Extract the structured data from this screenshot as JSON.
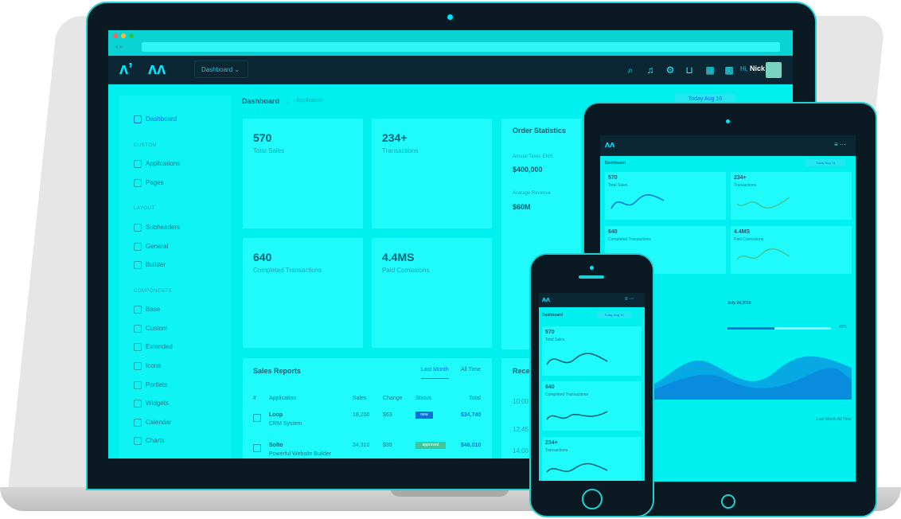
{
  "app": {
    "dropdown_label": "Dashboard",
    "greeting": "Hi,",
    "user_name": "Nick",
    "breadcrumb_title": "Dashboard",
    "breadcrumb_path": "Application",
    "date_button": "Today Aug 16"
  },
  "sidebar": {
    "active_item": "Dashboard",
    "sections": [
      {
        "heading": "CUSTOM",
        "items": [
          "Applications",
          "Pages"
        ]
      },
      {
        "heading": "LAYOUT",
        "items": [
          "Subheaders",
          "General",
          "Builder"
        ]
      },
      {
        "heading": "COMPONENTS",
        "items": [
          "Base",
          "Custom",
          "Extended",
          "Icons",
          "Portlets",
          "Widgets",
          "Calendar",
          "Charts"
        ]
      }
    ]
  },
  "stats": [
    {
      "value": "570",
      "label": "Total Sales"
    },
    {
      "value": "234+",
      "label": "Transactions"
    },
    {
      "value": "640",
      "label": "Completed Transactions"
    },
    {
      "value": "4.4MS",
      "label": "Paid Comissions"
    }
  ],
  "order_statistics": {
    "title": "Order Statistics",
    "annual_label": "Annual Taxes EMS",
    "annual_value": "$400,000",
    "avg_label": "Avarage Revenue",
    "avg_value": "$60M"
  },
  "sales_reports": {
    "title": "Sales Reports",
    "tabs": [
      "Last Month",
      "All Time"
    ],
    "columns": [
      "#",
      "Application",
      "Sales",
      "Change",
      "Status",
      "Total"
    ],
    "rows": [
      {
        "name": "Loop",
        "desc": "CRM System",
        "sales": "18,200",
        "change": "$63",
        "status": "new",
        "total": "$34,740"
      },
      {
        "name": "Solto",
        "desc": "Powerful Website Builder",
        "sales": "24,310",
        "change": "$39",
        "status": "approved",
        "total": "$46,010"
      }
    ]
  },
  "recent": {
    "title": "Recen",
    "times": [
      "10:00",
      "12:45",
      "14:00"
    ]
  },
  "tablet": {
    "breadcrumb": "Dashboard",
    "date_button": "Today Aug 16",
    "cards": [
      {
        "value": "570",
        "label": "Total Sales"
      },
      {
        "value": "234+",
        "label": "Transactions"
      },
      {
        "value": "640",
        "label": "Completed Transactions"
      },
      {
        "value": "4.4MS",
        "label": "Paid Comissions"
      }
    ],
    "date_label": "July 24,2019",
    "progress_value": "45%",
    "progress": 0.45,
    "tabs": [
      "Last Month",
      "All Time"
    ]
  },
  "phone": {
    "breadcrumb": "Dashboard",
    "date_button": "Today Aug 16",
    "cards": [
      {
        "value": "570",
        "label": "Total Sales"
      },
      {
        "value": "640",
        "label": "Completed Transactions"
      },
      {
        "value": "234+",
        "label": "Transactions"
      }
    ]
  },
  "colors": {
    "screen_bg": "#00f0f0",
    "header_bg": "#0a2733",
    "accent": "#0b6fd8",
    "device_frame": "#0b1a22"
  }
}
